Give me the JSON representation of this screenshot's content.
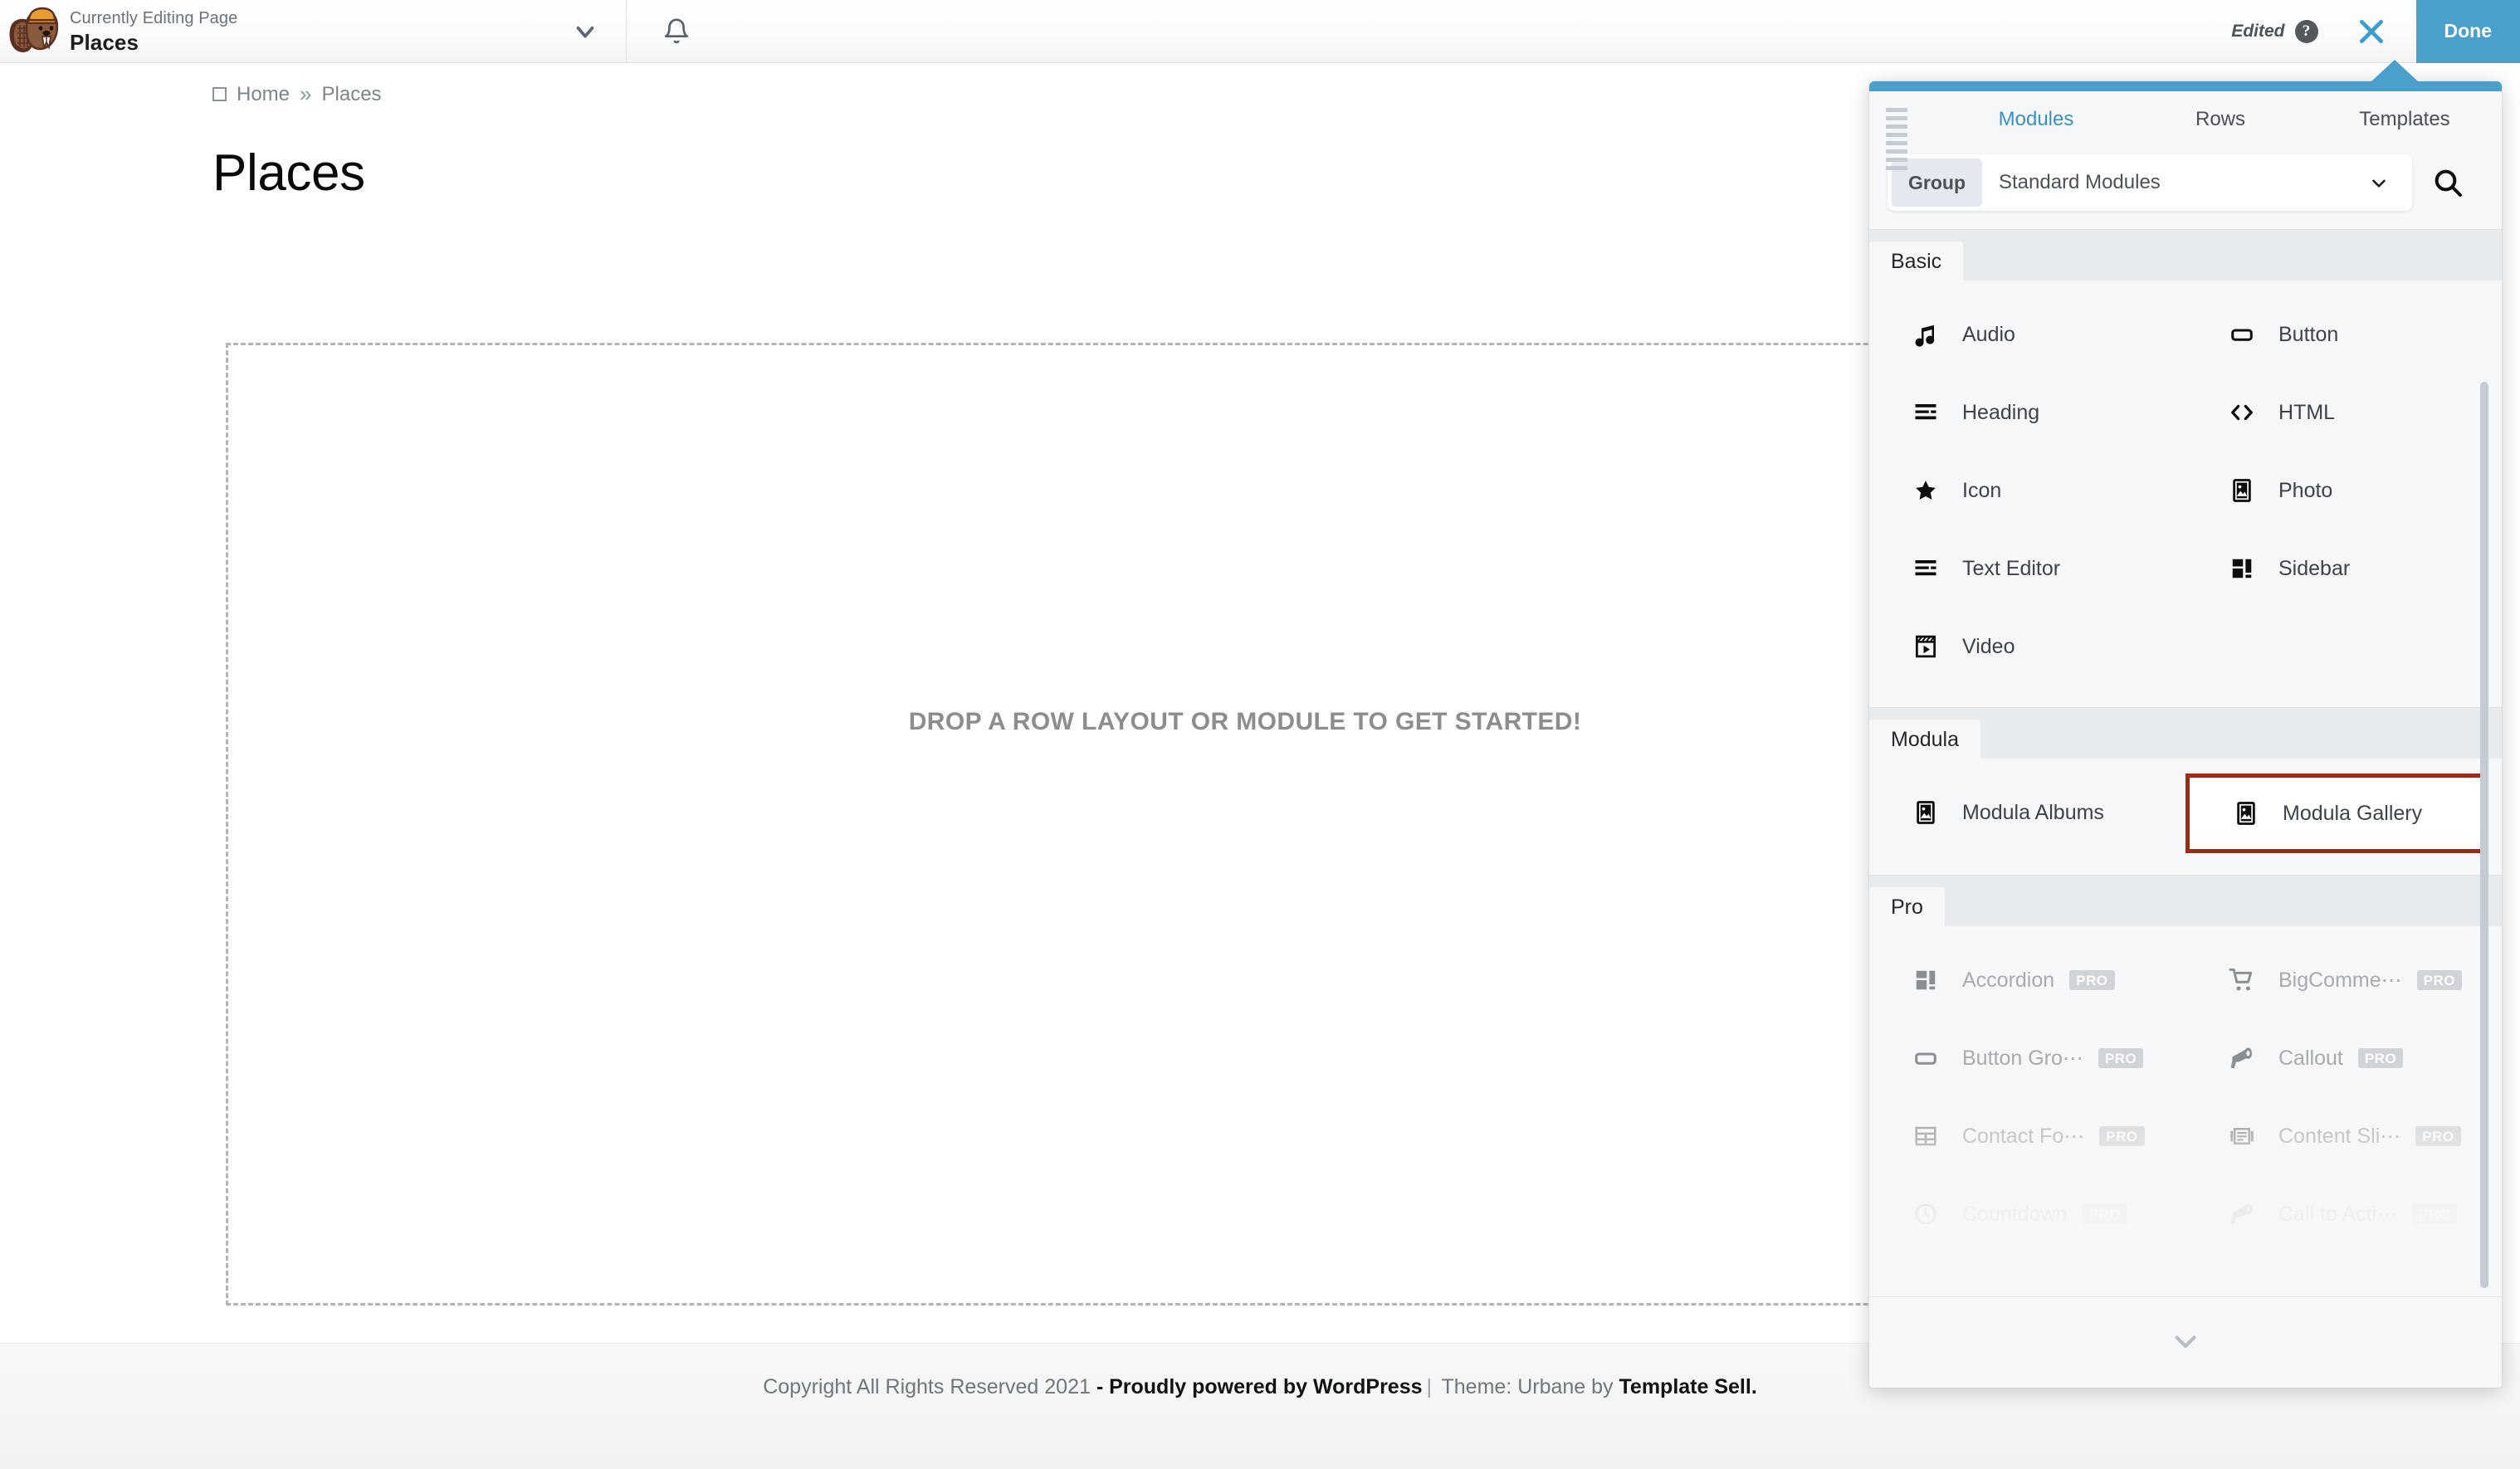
{
  "admin_bar": {
    "logo_name": "beaver-builder-logo",
    "currently_editing_label": "Currently Editing Page",
    "page_title": "Places",
    "edited_label": "Edited",
    "help_glyph": "?",
    "done_label": "Done"
  },
  "page": {
    "breadcrumb": {
      "home": "Home",
      "separator": "»",
      "current": "Places"
    },
    "entry_title": "Places",
    "drop_zone_text": "Drop a row layout or module to get started!",
    "footer": {
      "copyright": "Copyright All Rights Reserved 2021 ",
      "dash": "- ",
      "wordpress": "Proudly powered by WordPress",
      "separator": "|",
      "theme": " Theme: Urbane by ",
      "theme_author": "Template Sell."
    }
  },
  "panel": {
    "tabs": [
      {
        "label": "Modules",
        "active": true
      },
      {
        "label": "Rows",
        "active": false
      },
      {
        "label": "Templates",
        "active": false
      }
    ],
    "group_label": "Group",
    "group_value": "Standard Modules",
    "search_icon": "search-icon",
    "sections": [
      {
        "name": "Basic",
        "modules": [
          {
            "label": "Audio",
            "icon": "music-note-icon",
            "pro": false,
            "highlighted": false
          },
          {
            "label": "Button",
            "icon": "button-icon",
            "pro": false,
            "highlighted": false
          },
          {
            "label": "Heading",
            "icon": "heading-icon",
            "pro": false,
            "highlighted": false
          },
          {
            "label": "HTML",
            "icon": "code-icon",
            "pro": false,
            "highlighted": false
          },
          {
            "label": "Icon",
            "icon": "star-icon",
            "pro": false,
            "highlighted": false
          },
          {
            "label": "Photo",
            "icon": "photo-icon",
            "pro": false,
            "highlighted": false
          },
          {
            "label": "Text Editor",
            "icon": "text-editor-icon",
            "pro": false,
            "highlighted": false
          },
          {
            "label": "Sidebar",
            "icon": "sidebar-icon",
            "pro": false,
            "highlighted": false
          },
          {
            "label": "Video",
            "icon": "video-icon",
            "pro": false,
            "highlighted": false
          }
        ]
      },
      {
        "name": "Modula",
        "modules": [
          {
            "label": "Modula Albums",
            "icon": "photo-icon",
            "pro": false,
            "highlighted": false
          },
          {
            "label": "Modula Gallery",
            "icon": "photo-icon",
            "pro": false,
            "highlighted": true
          }
        ]
      },
      {
        "name": "Pro",
        "modules": [
          {
            "label": "Accordion",
            "icon": "sidebar-icon",
            "pro": true,
            "pro_badge": "PRO",
            "highlighted": false
          },
          {
            "label": "BigComme⋯",
            "icon": "cart-icon",
            "pro": true,
            "pro_badge": "PRO",
            "highlighted": false
          },
          {
            "label": "Button Gro⋯",
            "icon": "button-icon",
            "pro": true,
            "pro_badge": "PRO",
            "highlighted": false
          },
          {
            "label": "Callout",
            "icon": "megaphone-icon",
            "pro": true,
            "pro_badge": "PRO",
            "highlighted": false
          },
          {
            "label": "Contact Fo⋯",
            "icon": "table-icon",
            "pro": true,
            "pro_badge": "PRO",
            "highlighted": false
          },
          {
            "label": "Content Sli⋯",
            "icon": "slider-icon",
            "pro": true,
            "pro_badge": "PRO",
            "highlighted": false
          },
          {
            "label": "Countdown",
            "icon": "clock-icon",
            "pro": true,
            "pro_badge": "PRO",
            "highlighted": false
          },
          {
            "label": "Call to Acti⋯",
            "icon": "megaphone-icon",
            "pro": true,
            "pro_badge": "PRO",
            "highlighted": false
          }
        ]
      }
    ],
    "expand_icon": "chevron-down-icon"
  },
  "colors": {
    "accent_blue": "#4a9fcb",
    "highlight_red": "#9c2a17",
    "panel_bg": "#f6f7f8"
  }
}
